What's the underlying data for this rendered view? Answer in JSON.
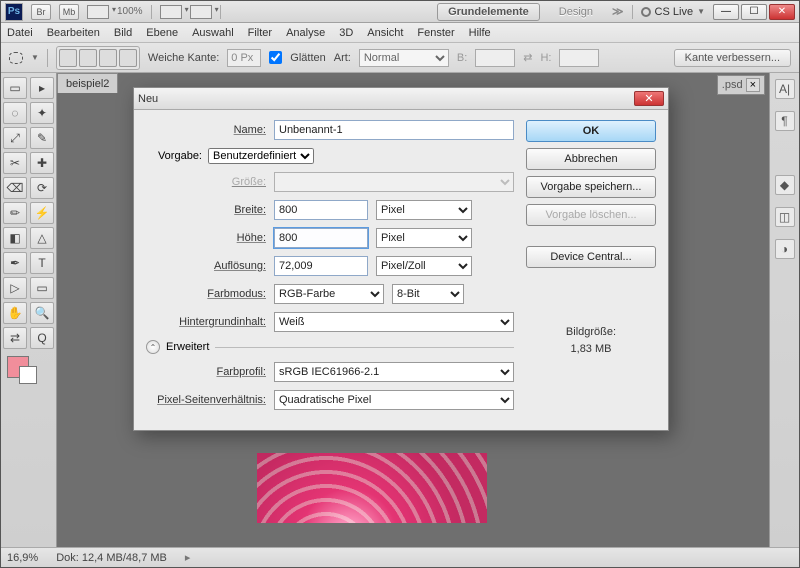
{
  "titlebar": {
    "logo": "Ps",
    "br": "Br",
    "mb": "Mb",
    "zoom": "100%",
    "pill_main": "Grundelemente",
    "pill_design": "Design",
    "chev": "≫",
    "cslive": "CS Live"
  },
  "menu": {
    "items": [
      "Datei",
      "Bearbeiten",
      "Bild",
      "Ebene",
      "Auswahl",
      "Filter",
      "Analyse",
      "3D",
      "Ansicht",
      "Fenster",
      "Hilfe"
    ]
  },
  "options": {
    "feather_label": "Weiche Kante:",
    "feather_val": "0 Px",
    "antialias": "Glätten",
    "style_label": "Art:",
    "style_val": "Normal",
    "w_label": "B:",
    "h_label": "H:",
    "refine": "Kante verbessern..."
  },
  "docs": {
    "tab1": "beispiel2",
    "tab2_suffix": ".psd"
  },
  "status": {
    "zoom": "16,9%",
    "doc": "Dok: 12,4 MB/48,7 MB"
  },
  "dialog": {
    "title": "Neu",
    "name_label": "Name:",
    "name_val": "Unbenannt-1",
    "preset_label": "Vorgabe:",
    "preset_val": "Benutzerdefiniert",
    "size_label": "Größe:",
    "width_label": "Breite:",
    "width_val": "800",
    "height_label": "Höhe:",
    "height_val": "800",
    "unit_pixel": "Pixel",
    "res_label": "Auflösung:",
    "res_val": "72,009",
    "res_unit": "Pixel/Zoll",
    "mode_label": "Farbmodus:",
    "mode_val": "RGB-Farbe",
    "bit_val": "8-Bit",
    "bg_label": "Hintergrundinhalt:",
    "bg_val": "Weiß",
    "advanced": "Erweitert",
    "profile_label": "Farbprofil:",
    "profile_val": "sRGB IEC61966-2.1",
    "par_label": "Pixel-Seitenverhältnis:",
    "par_val": "Quadratische Pixel",
    "btn_ok": "OK",
    "btn_cancel": "Abbrechen",
    "btn_save": "Vorgabe speichern...",
    "btn_delete": "Vorgabe löschen...",
    "btn_device": "Device Central...",
    "size_head": "Bildgröße:",
    "size_val": "1,83 MB"
  },
  "tool_icons": [
    "▭",
    "▸",
    "◌",
    "✦",
    "⤢",
    "✎",
    "✂",
    "✚",
    "⌫",
    "⟳",
    "✏",
    "⚡",
    "◧",
    "△",
    "⬚",
    "●",
    "✒",
    "T",
    "▷",
    "▭",
    "✋",
    "🔍",
    "⇄",
    "Q"
  ]
}
